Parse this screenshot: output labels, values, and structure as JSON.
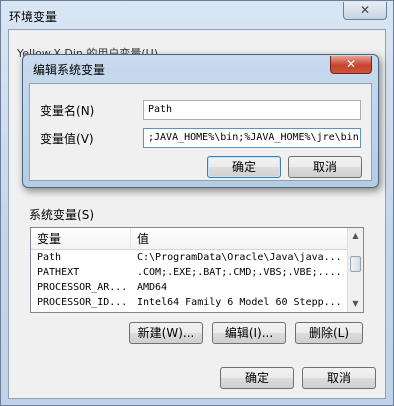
{
  "outer": {
    "title": "环境变量",
    "close_label": "✕",
    "user_group_label": "Yellow.X.Din 的用户变量(U)",
    "system_group_label": "系统变量",
    "system_group_access": "(S)",
    "list": {
      "headers": [
        "变量",
        "值"
      ],
      "rows": [
        {
          "name": "Path",
          "value": "C:\\ProgramData\\Oracle\\Java\\java..."
        },
        {
          "name": "PATHEXT",
          "value": ".COM;.EXE;.BAT;.CMD;.VBS;.VBE;...."
        },
        {
          "name": "PROCESSOR_AR...",
          "value": "AMD64"
        },
        {
          "name": "PROCESSOR_ID...",
          "value": "Intel64 Family 6 Model 60 Stepp..."
        }
      ]
    },
    "buttons": {
      "new_label": "新建",
      "new_access": "(W)...",
      "edit_label": "编辑",
      "edit_access": "(I)...",
      "delete_label": "删除",
      "delete_access": "(L)",
      "ok_label": "确定",
      "cancel_label": "取消"
    }
  },
  "dialog": {
    "title": "编辑系统变量",
    "close_label": "✕",
    "var_name_label": "变量名",
    "var_name_access": "(N)",
    "var_name_value": "Path",
    "var_value_label": "变量值",
    "var_value_access": "(V)",
    "var_value_value": ";JAVA_HOME%\\bin;%JAVA_HOME%\\jre\\bin;",
    "ok_label": "确定",
    "cancel_label": "取消"
  }
}
